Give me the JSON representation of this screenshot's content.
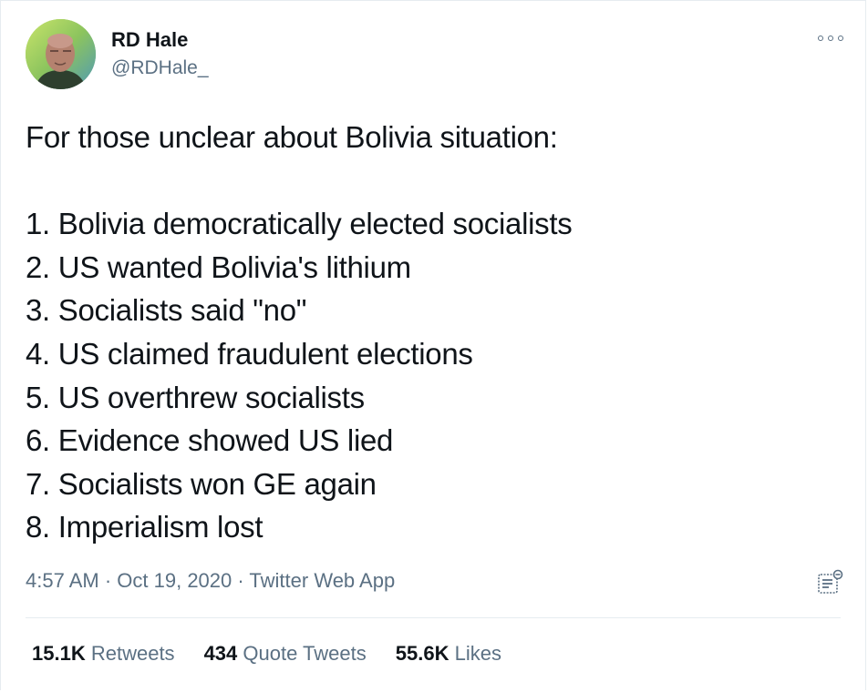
{
  "user": {
    "name": "RD Hale",
    "handle": "@RDHale_",
    "avatar_icon": "profile-photo"
  },
  "tweet": {
    "intro": "For those unclear about Bolivia situation:",
    "items": [
      "1. Bolivia democratically elected socialists",
      "2. US wanted Bolivia's lithium",
      "3. Socialists said \"no\"",
      "4. US claimed fraudulent elections",
      "5. US overthrew socialists",
      "6. Evidence showed US lied",
      "7. Socialists won GE again",
      "8. Imperialism lost"
    ]
  },
  "meta": {
    "time": "4:57 AM",
    "sep1": " · ",
    "date": "Oct 19, 2020",
    "sep2": " · ",
    "app": "Twitter Web App"
  },
  "stats": {
    "retweets_count": "15.1K",
    "retweets_label": "Retweets",
    "quotes_count": "434",
    "quotes_label": "Quote Tweets",
    "likes_count": "55.6K",
    "likes_label": "Likes"
  },
  "icons": {
    "more": "more-horizontal-icon",
    "analytics": "analytics-icon"
  },
  "colors": {
    "text_primary": "#0f1419",
    "text_secondary": "#5b7083",
    "border": "#e6ecf0"
  }
}
